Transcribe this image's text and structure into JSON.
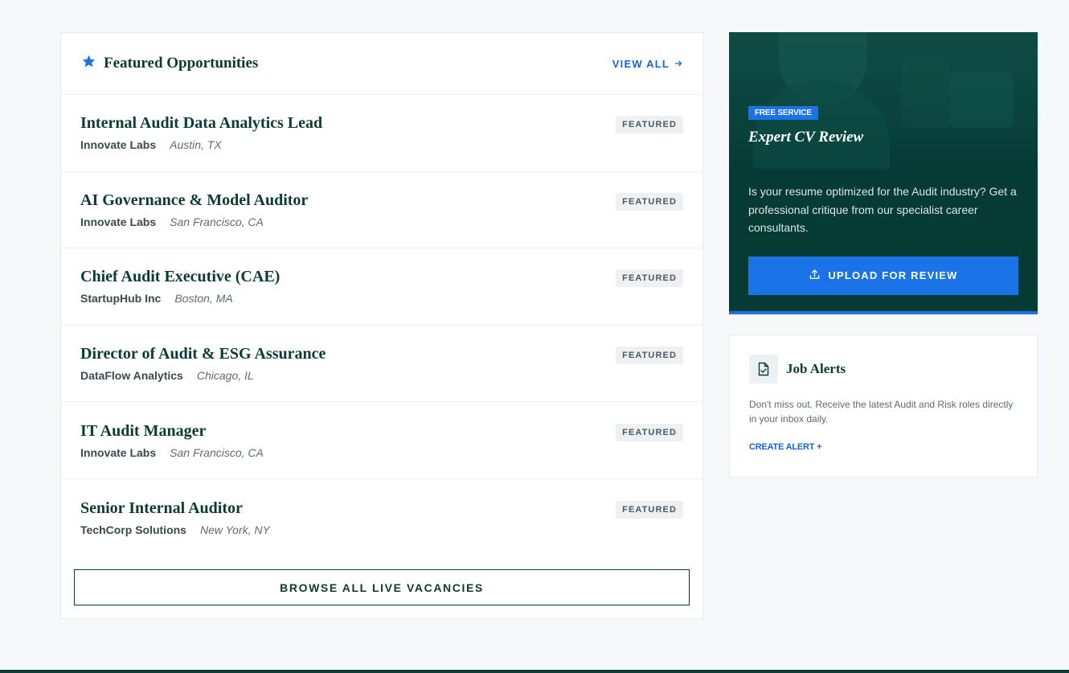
{
  "featured": {
    "title": "Featured Opportunities",
    "view_all": "VIEW ALL",
    "badge": "FEATURED",
    "browse": "BROWSE ALL LIVE VACANCIES",
    "jobs": [
      {
        "title": "Internal Audit Data Analytics Lead",
        "company": "Innovate Labs",
        "location": "Austin, TX"
      },
      {
        "title": "AI Governance & Model Auditor",
        "company": "Innovate Labs",
        "location": "San Francisco, CA"
      },
      {
        "title": "Chief Audit Executive (CAE)",
        "company": "StartupHub Inc",
        "location": "Boston, MA"
      },
      {
        "title": "Director of Audit & ESG Assurance",
        "company": "DataFlow Analytics",
        "location": "Chicago, IL"
      },
      {
        "title": "IT Audit Manager",
        "company": "Innovate Labs",
        "location": "San Francisco, CA"
      },
      {
        "title": "Senior Internal Auditor",
        "company": "TechCorp Solutions",
        "location": "New York, NY"
      }
    ]
  },
  "promo": {
    "badge": "FREE SERVICE",
    "title": "Expert CV Review",
    "description": "Is your resume optimized for the Audit industry? Get a professional critique from our specialist career consultants.",
    "button": "UPLOAD FOR REVIEW"
  },
  "alerts": {
    "title": "Job Alerts",
    "description": "Don't miss out. Receive the latest Audit and Risk roles directly in your inbox daily.",
    "link": "CREATE ALERT +"
  },
  "colors": {
    "brand_dark": "#0b3b36",
    "accent_blue": "#1b73e8",
    "background": "#f6f8fa"
  },
  "icons": [
    "star-icon",
    "arrow-right-icon",
    "upload-icon",
    "file-check-icon"
  ]
}
